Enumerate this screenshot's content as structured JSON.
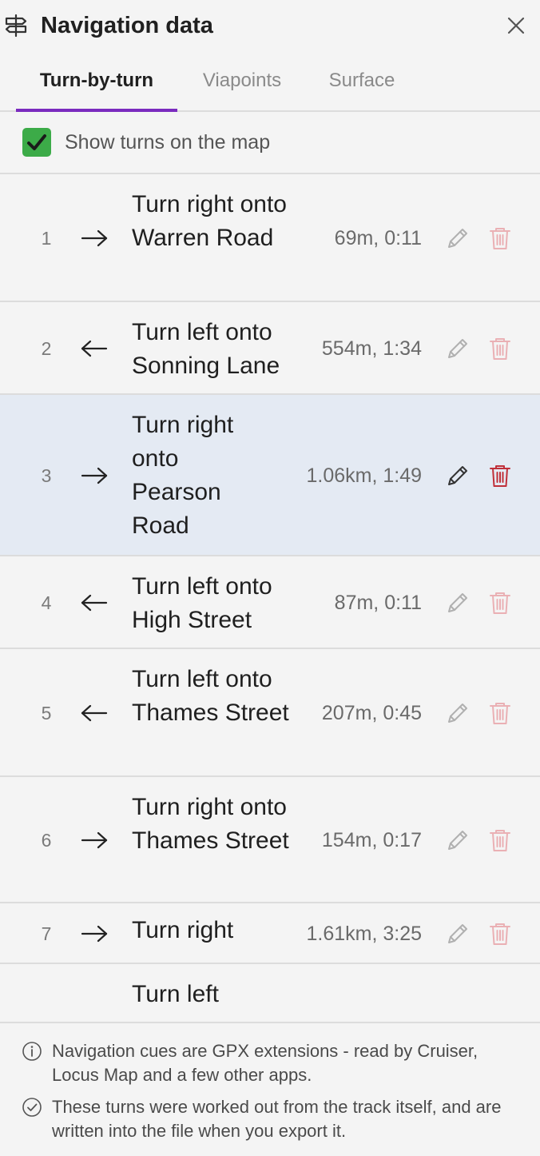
{
  "header": {
    "title": "Navigation data",
    "icon": "signpost-icon",
    "close_icon": "close-icon"
  },
  "tabs": [
    {
      "label": "Turn-by-turn",
      "active": true
    },
    {
      "label": "Viapoints",
      "active": false
    },
    {
      "label": "Surface",
      "active": false
    }
  ],
  "show_turns": {
    "label": "Show turns on the map",
    "checked": true
  },
  "turns": [
    {
      "num": "1",
      "direction": "right",
      "text": "Turn right onto Warren Road",
      "dist": "69m, 0:11"
    },
    {
      "num": "2",
      "direction": "left",
      "text": "Turn left onto Sonning Lane",
      "dist": "554m, 1:34"
    },
    {
      "num": "3",
      "direction": "right",
      "text": "Turn right onto Pearson Road",
      "dist": "1.06km, 1:49",
      "selected": true
    },
    {
      "num": "4",
      "direction": "left",
      "text": "Turn left onto High Street",
      "dist": "87m, 0:11"
    },
    {
      "num": "5",
      "direction": "left",
      "text": "Turn left onto Thames Street",
      "dist": "207m, 0:45"
    },
    {
      "num": "6",
      "direction": "right",
      "text": "Turn right onto Thames Street",
      "dist": "154m, 0:17"
    },
    {
      "num": "7",
      "direction": "right",
      "text": "Turn right",
      "dist": "1.61km, 3:25"
    },
    {
      "num": "",
      "direction": "",
      "text": "Turn left",
      "dist": ""
    }
  ],
  "footer": {
    "info_note": "Navigation cues are GPX extensions - read by Cruiser, Locus Map and a few other apps.",
    "check_note": "These turns were worked out from the track itself, and are written into the file when you export it."
  },
  "colors": {
    "accent": "#7a2bbf",
    "checkbox": "#3cab48",
    "delete": "#c0303a",
    "selected_row": "#e4eaf3"
  }
}
